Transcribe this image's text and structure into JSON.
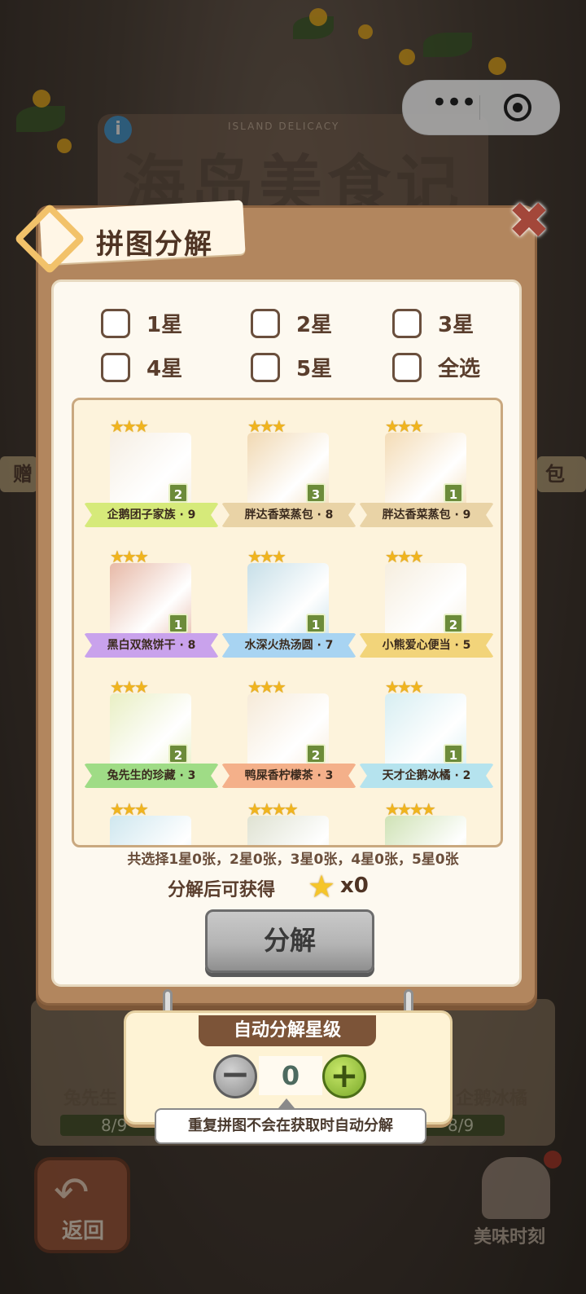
{
  "background": {
    "logo_title": "海岛美食记",
    "logo_subtitle": "ISLAND DELICACY",
    "info_icon": "info-icon",
    "side_left_label": "赠",
    "side_right_label": "包",
    "bottom_card_labels": [
      "兔先生",
      "企鹅冰橘"
    ],
    "bottom_card_counts": [
      "8/9",
      "8/9"
    ],
    "back_label": "返回",
    "tasty_label": "美味时刻"
  },
  "capsule": {
    "more_icon": "more-dots-icon",
    "close_icon": "target-close-icon"
  },
  "dialog": {
    "title": "拼图分解",
    "close_icon": "close-x-icon",
    "filters": [
      {
        "label": "1星",
        "checked": false
      },
      {
        "label": "2星",
        "checked": false
      },
      {
        "label": "3星",
        "checked": false
      },
      {
        "label": "4星",
        "checked": false
      },
      {
        "label": "5星",
        "checked": false
      },
      {
        "label": "全选",
        "checked": false
      }
    ],
    "cards": [
      {
        "name": "企鹅团子家族 · 9",
        "stars": "★★★",
        "count": "2",
        "ribbon": "#d6ea7a",
        "art": "#f6efe4"
      },
      {
        "name": "胖达香菜蒸包 · 8",
        "stars": "★★★",
        "count": "3",
        "ribbon": "#e9d3a6",
        "art": "#f1d9b3"
      },
      {
        "name": "胖达香菜蒸包 · 9",
        "stars": "★★★",
        "count": "1",
        "ribbon": "#e9d3a6",
        "art": "#f4dcb6"
      },
      {
        "name": "黑白双煞饼干 · 8",
        "stars": "★★★",
        "count": "1",
        "ribbon": "#c9a2ec",
        "art": "#e7b9a7"
      },
      {
        "name": "水深火热汤圆 · 7",
        "stars": "★★★",
        "count": "1",
        "ribbon": "#a8d4f2",
        "art": "#c7dfe8"
      },
      {
        "name": "小熊爱心便当 · 5",
        "stars": "★★★",
        "count": "2",
        "ribbon": "#f2d47a",
        "art": "#f6eedf"
      },
      {
        "name": "兔先生的珍藏 · 3",
        "stars": "★★★",
        "count": "2",
        "ribbon": "#9fdc86",
        "art": "#e9efc4"
      },
      {
        "name": "鸭屎香柠檬茶 · 3",
        "stars": "★★★",
        "count": "2",
        "ribbon": "#f4b08a",
        "art": "#f6ead8"
      },
      {
        "name": "天才企鹅冰橘 · 2",
        "stars": "★★★",
        "count": "1",
        "ribbon": "#b5e3ee",
        "art": "#d7eef2"
      },
      {
        "name": "",
        "stars": "★★★",
        "count": "",
        "ribbon": "",
        "art": "#cfe7ef"
      },
      {
        "name": "",
        "stars": "★★★★",
        "count": "",
        "ribbon": "",
        "art": "#dfe2d2"
      },
      {
        "name": "",
        "stars": "★★★★",
        "count": "",
        "ribbon": "",
        "art": "#cfe2b5"
      }
    ],
    "summary": "共选择1星0张，2星0张，3星0张，4星0张，5星0张",
    "obtain_label": "分解后可获得",
    "obtain_star_icon": "star-icon",
    "obtain_value": "x0",
    "decompose_button": "分解"
  },
  "auto_panel": {
    "title": "自动分解星级",
    "minus": "−",
    "value": "0",
    "plus": "+",
    "tip": "重复拼图不会在获取时自动分解"
  }
}
